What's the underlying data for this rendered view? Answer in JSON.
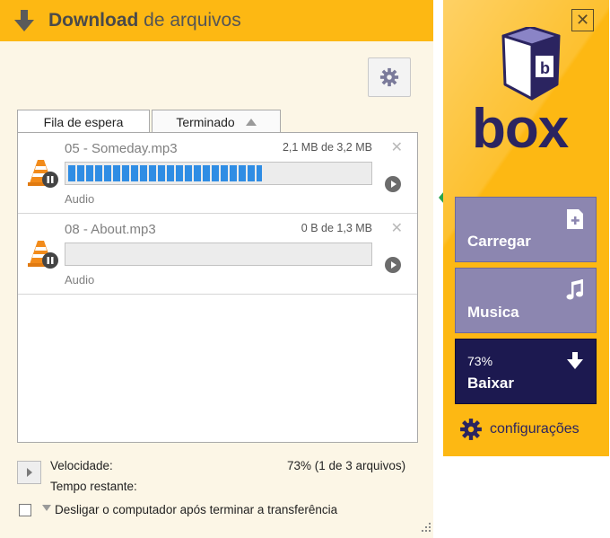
{
  "window": {
    "title_bold": "Download",
    "title_rest": "de arquivos"
  },
  "tabs": [
    {
      "label": "Fila de espera"
    },
    {
      "label": "Terminado"
    }
  ],
  "downloads": [
    {
      "name": "05 - Someday.mp3",
      "size": "2,1 MB de 3,2 MB",
      "type": "Audio",
      "progress": 0.65
    },
    {
      "name": "08 - About.mp3",
      "size": "0 B de 1,3 MB",
      "type": "Audio",
      "progress": 0.0
    }
  ],
  "footer": {
    "speed_label": "Velocidade:",
    "time_label": "Tempo restante:",
    "overall": "73% (1 de 3 arquivos)",
    "shutdown_label": "Desligar o computador após terminar a transferência"
  },
  "sidebar": {
    "logo_text": "box",
    "buttons": [
      {
        "label": "Carregar",
        "icon": "file-add-icon"
      },
      {
        "label": "Musica",
        "icon": "music-note-icon"
      },
      {
        "label": "Baixar",
        "icon": "download-arrow-icon",
        "percent": "73%"
      }
    ],
    "settings_label": "configurações"
  },
  "colors": {
    "accent_yellow": "#fdb813",
    "box_navy": "#2b2460",
    "progress_blue": "#2f8de4",
    "button_purple": "#8c86b0"
  }
}
